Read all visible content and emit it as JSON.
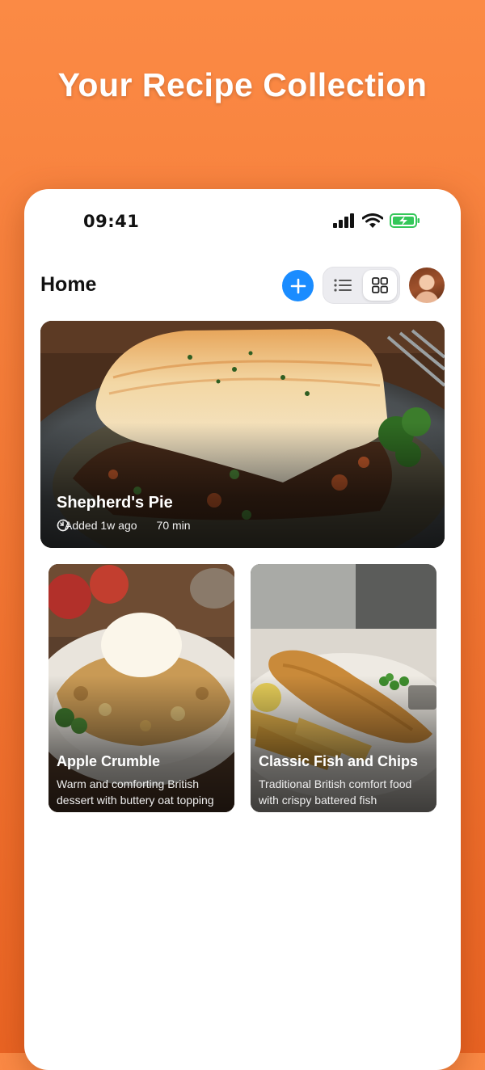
{
  "page": {
    "headline": "Your Recipe Collection"
  },
  "status_bar": {
    "time": "09:41",
    "battery": "charging"
  },
  "header": {
    "title": "Home",
    "add_icon": "plus-icon",
    "view_modes": [
      "list",
      "grid"
    ],
    "selected_view": "grid"
  },
  "featured": {
    "title": "Shepherd's Pie",
    "added": "Added 1w ago",
    "duration": "70 min"
  },
  "recipes": [
    {
      "title": "Apple Crumble",
      "description": "Warm and comforting British dessert with buttery oat topping"
    },
    {
      "title": "Classic Fish and Chips",
      "description": "Traditional British comfort food with crispy battered fish"
    }
  ],
  "colors": {
    "background_top": "#fb8a45",
    "background_bottom": "#ea6423",
    "accent": "#1a8cff",
    "battery": "#34c759"
  }
}
